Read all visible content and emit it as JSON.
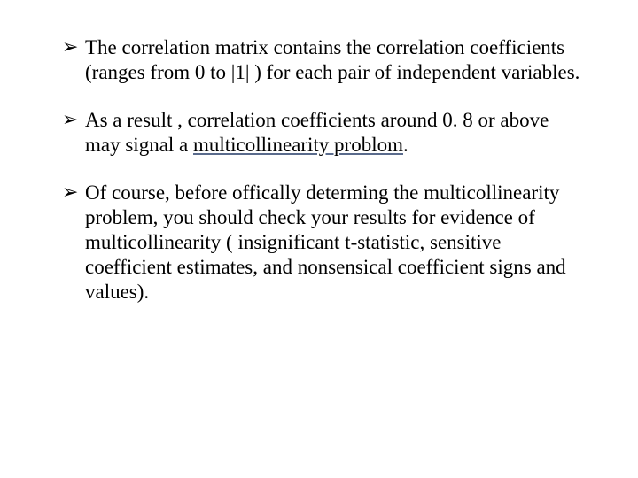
{
  "bullets": [
    {
      "text": "The correlation matrix contains the correlation coefficients (ranges from 0 to |1| )  for each pair of independent variables."
    },
    {
      "prefix": "As a result , correlation coefficients around 0. 8 or above may signal a ",
      "underlined": "multicollinearity problom",
      "suffix": "."
    },
    {
      "text": "Of course, before offically determing the multicollinearity problem, you should check your results for evidence of multicollinearity ( insignificant t-statistic, sensitive coefficient estimates, and nonsensical coefficient signs and values)."
    }
  ]
}
